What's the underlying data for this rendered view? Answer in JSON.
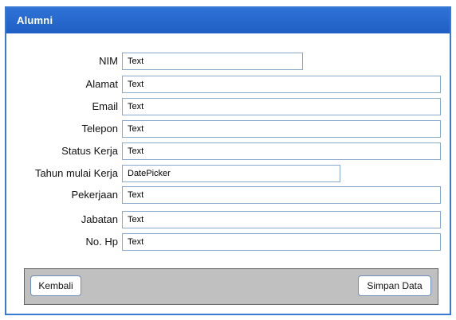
{
  "window": {
    "title": "Alumni"
  },
  "form": {
    "fields": [
      {
        "label": "NIM",
        "value": "Text"
      },
      {
        "label": "Alamat",
        "value": "Text"
      },
      {
        "label": "Email",
        "value": "Text"
      },
      {
        "label": "Telepon",
        "value": "Text"
      },
      {
        "label": "Status Kerja",
        "value": "Text"
      },
      {
        "label": "Tahun mulai Kerja",
        "value": "DatePicker"
      },
      {
        "label": "Pekerjaan",
        "value": "Text"
      },
      {
        "label": "Jabatan",
        "value": "Text"
      },
      {
        "label": "No. Hp",
        "value": "Text"
      }
    ]
  },
  "actions": {
    "back_label": "Kembali",
    "save_label": "Simpan Data"
  },
  "colors": {
    "titlebar": "#2f72d6",
    "frame": "#3a79d3",
    "field_border": "#8aa8cc",
    "toolbar_bg": "#c0c0c0"
  }
}
